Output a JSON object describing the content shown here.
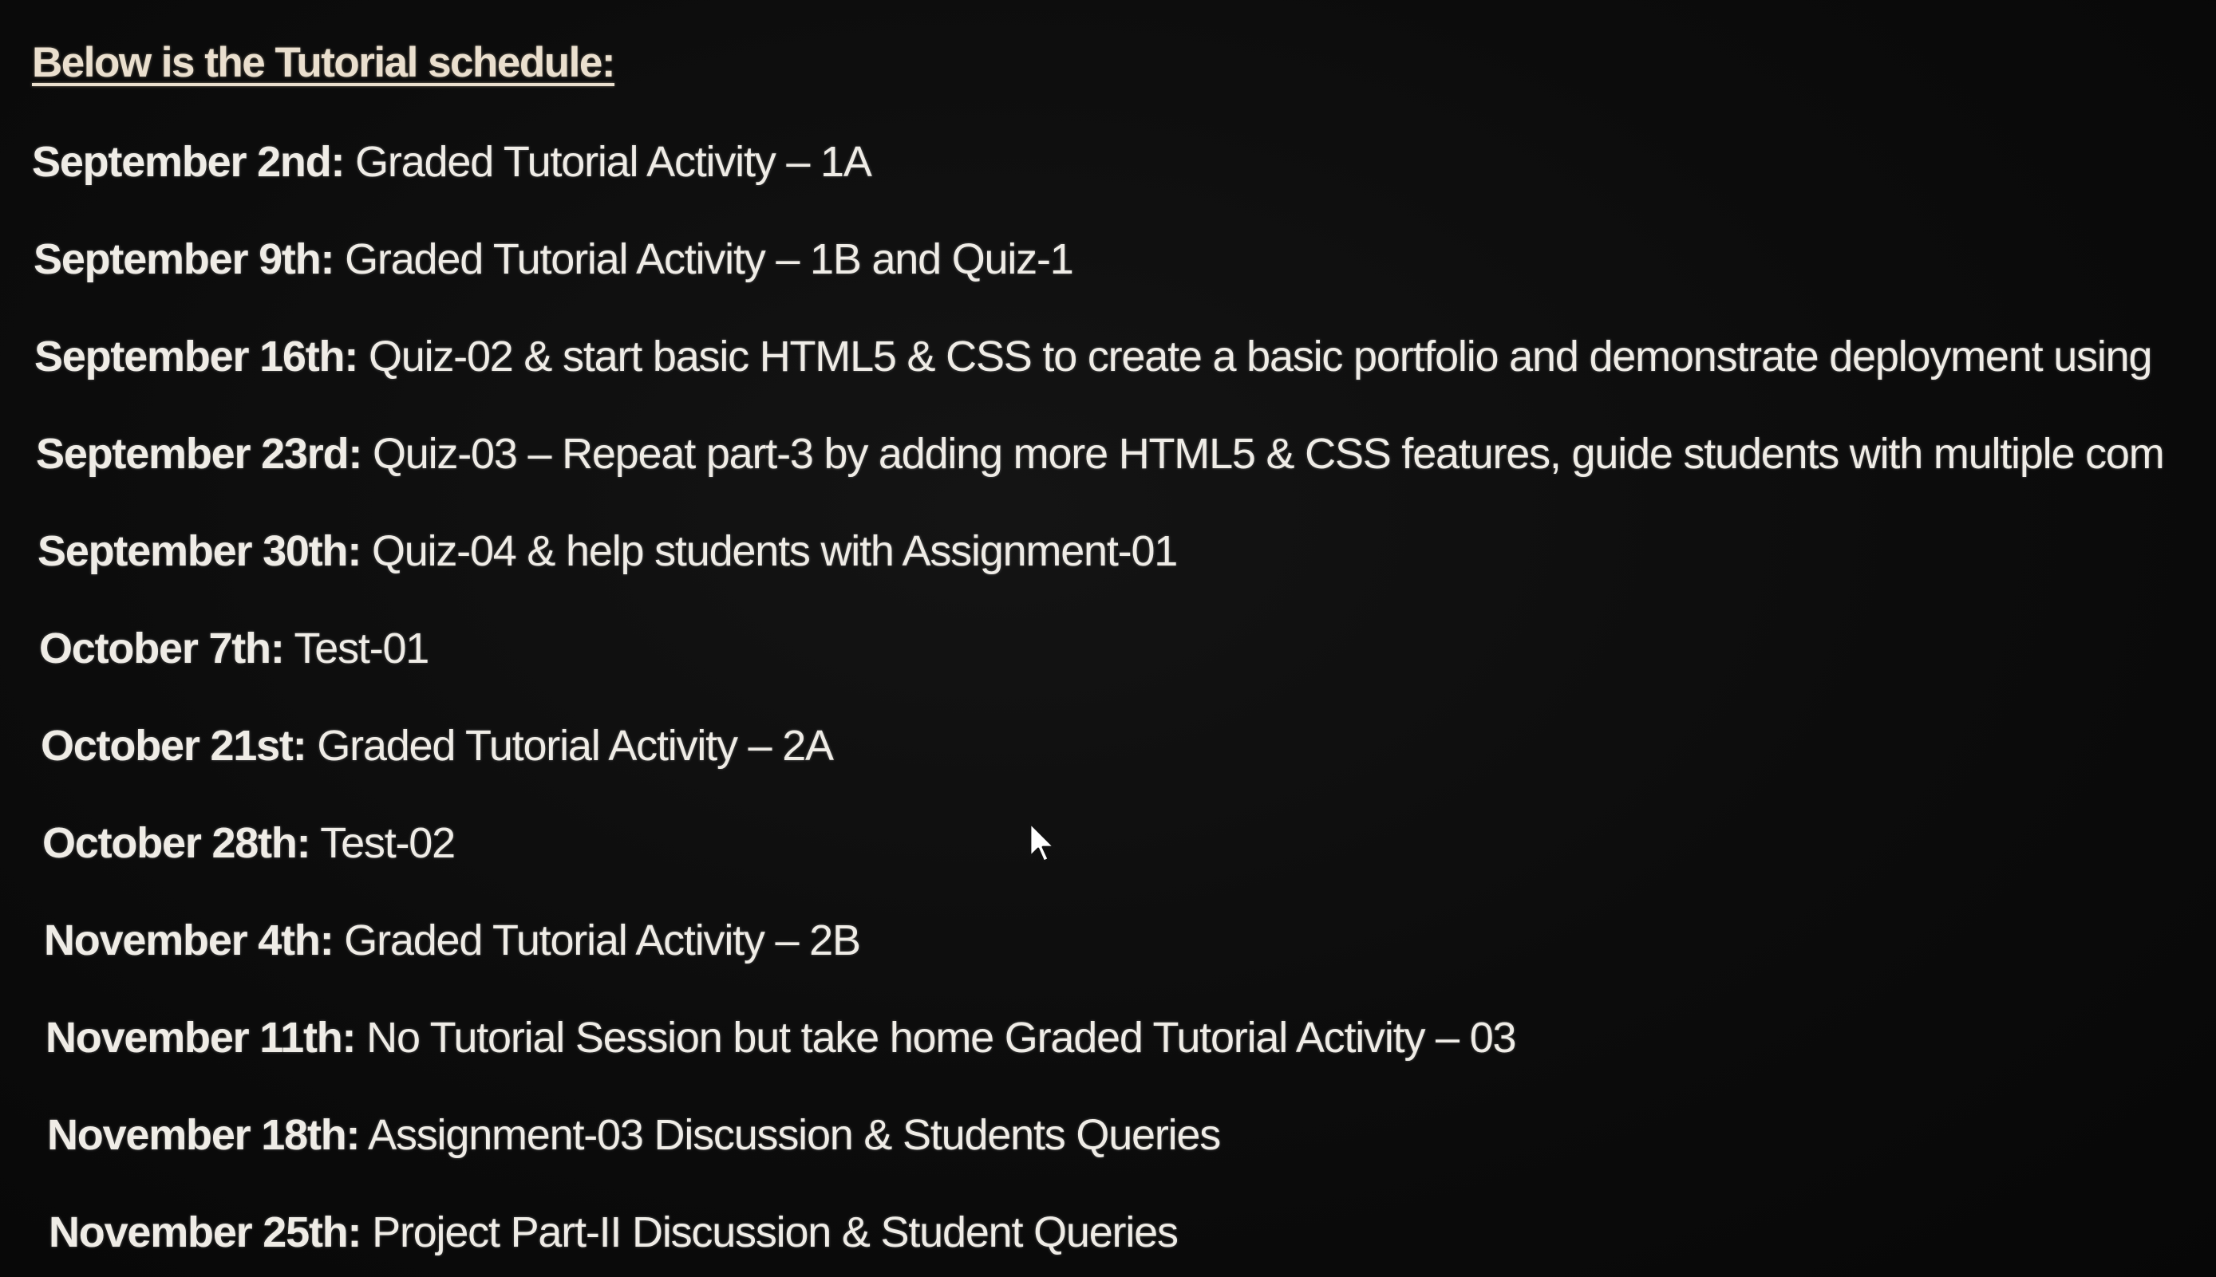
{
  "document": {
    "heading": "Below is the Tutorial schedule:",
    "schedule": [
      {
        "date": "September 2nd:",
        "activity": "Graded Tutorial Activity – 1A"
      },
      {
        "date": "September 9th:",
        "activity": "Graded Tutorial Activity – 1B and Quiz-1"
      },
      {
        "date": "September 16th:",
        "activity": "Quiz-02 & start basic HTML5 & CSS to create a basic portfolio and demonstrate deployment using"
      },
      {
        "date": "September 23rd:",
        "activity": "Quiz-03 – Repeat part-3 by adding more HTML5 & CSS features, guide students with multiple com"
      },
      {
        "date": "September 30th:",
        "activity": "Quiz-04 & help students with Assignment-01"
      },
      {
        "date": "October 7th:",
        "activity": "Test-01"
      },
      {
        "date": "October 21st:",
        "activity": "Graded Tutorial Activity – 2A"
      },
      {
        "date": "October 28th:",
        "activity": "Test-02"
      },
      {
        "date": "November 4th:",
        "activity": "Graded Tutorial Activity – 2B"
      },
      {
        "date": "November 11th:",
        "activity": "No Tutorial Session but take home Graded Tutorial Activity – 03"
      },
      {
        "date": "November 18th:",
        "activity": "Assignment-03 Discussion & Students Queries"
      },
      {
        "date": "November 25th:",
        "activity": "Project Part-II Discussion & Student Queries"
      }
    ]
  },
  "pointer": {
    "icon": "mouse-pointer-icon"
  },
  "colors": {
    "background": "#0b0b0b",
    "text": "#efece6",
    "heading": "#eadfce"
  }
}
